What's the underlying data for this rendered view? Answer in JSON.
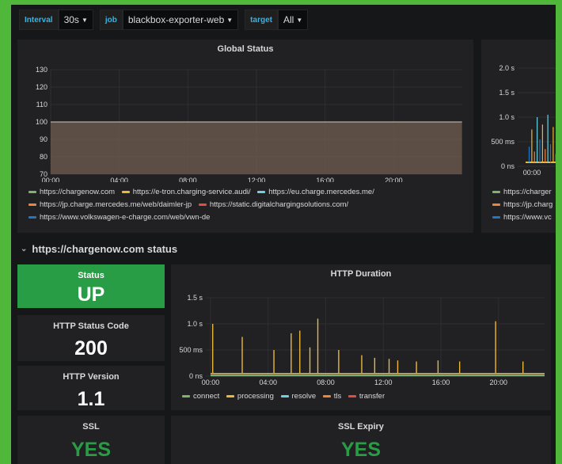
{
  "toolbar": {
    "variables": [
      {
        "label": "Interval",
        "value": "30s"
      },
      {
        "label": "job",
        "value": "blackbox-exporter-web"
      },
      {
        "label": "target",
        "value": "All"
      }
    ]
  },
  "colors": {
    "green": "#7eb26d",
    "yellow": "#eab839",
    "cyan": "#6ed0e0",
    "orange": "#ef843c",
    "red": "#e24d42",
    "blue": "#1f78c1",
    "status_up_bg": "#299c46",
    "ok_text": "#299c46"
  },
  "global_status": {
    "title": "Global Status",
    "legend": [
      {
        "label": "https://chargenow.com",
        "color": "#7eb26d"
      },
      {
        "label": "https://e-tron.charging-service.audi/",
        "color": "#eab839"
      },
      {
        "label": "https://eu.charge.mercedes.me/",
        "color": "#6ed0e0"
      },
      {
        "label": "https://jp.charge.mercedes.me/web/daimler-jp",
        "color": "#ef843c"
      },
      {
        "label": "https://static.digitalchargingsolutions.com/",
        "color": "#e24d42"
      },
      {
        "label": "https://www.volkswagen-e-charge.com/web/vwn-de",
        "color": "#1f78c1"
      }
    ]
  },
  "duration_panel": {
    "legend": [
      {
        "label": "https://charger",
        "color": "#7eb26d"
      },
      {
        "label": "https://jp.charg",
        "color": "#ef843c"
      },
      {
        "label": "https://www.vc",
        "color": "#1f78c1"
      }
    ]
  },
  "row": {
    "title": "https://chargenow.com status"
  },
  "stats": {
    "status": {
      "label": "Status",
      "value": "UP"
    },
    "http_status_code": {
      "label": "HTTP Status Code",
      "value": "200"
    },
    "http_version": {
      "label": "HTTP Version",
      "value": "1.1"
    },
    "ssl": {
      "label": "SSL",
      "value": "YES"
    },
    "ssl_expiry": {
      "label": "SSL Expiry",
      "value": "YES"
    }
  },
  "http_duration": {
    "title": "HTTP Duration",
    "legend": [
      {
        "label": "connect",
        "color": "#7eb26d"
      },
      {
        "label": "processing",
        "color": "#eab839"
      },
      {
        "label": "resolve",
        "color": "#6ed0e0"
      },
      {
        "label": "tls",
        "color": "#ef843c"
      },
      {
        "label": "transfer",
        "color": "#e24d42"
      }
    ]
  },
  "chart_data": [
    {
      "type": "area",
      "title": "Global Status",
      "x_ticks": [
        "00:00",
        "04:00",
        "08:00",
        "12:00",
        "16:00",
        "20:00"
      ],
      "y_ticks": [
        "70",
        "80",
        "90",
        "100",
        "110",
        "120",
        "130"
      ],
      "ylim": [
        70,
        130
      ],
      "grid": true,
      "legend_position": "bottom",
      "series": [
        {
          "name": "https://chargenow.com",
          "x": [
            "00:00",
            "23:59"
          ],
          "values": [
            100,
            100
          ]
        }
      ]
    },
    {
      "type": "line",
      "x_ticks": [
        "00:00"
      ],
      "y_ticks": [
        "0 ns",
        "500 ms",
        "1.0 s",
        "1.5 s",
        "2.0 s"
      ],
      "ylim": [
        0,
        2.0
      ],
      "grid": true,
      "legend_position": "bottom",
      "spike_times": [
        0.2,
        0.35,
        0.5,
        0.65,
        0.8,
        0.95,
        1.1,
        1.25,
        1.4,
        1.55,
        1.7,
        1.85,
        2.0,
        2.15,
        2.3
      ],
      "spike_values": [
        0.4,
        0.75,
        0.3,
        1.0,
        0.55,
        0.85,
        0.35,
        1.05,
        0.45,
        0.8,
        0.25,
        1.0,
        0.6,
        0.9,
        0.5
      ],
      "baseline": 0.08
    },
    {
      "type": "line",
      "title": "HTTP Duration",
      "x_ticks": [
        "00:00",
        "04:00",
        "08:00",
        "12:00",
        "16:00",
        "20:00"
      ],
      "y_ticks": [
        "0 ns",
        "500 ms",
        "1.0 s",
        "1.5 s"
      ],
      "ylim": [
        0,
        1.5
      ],
      "grid": true,
      "legend_position": "bottom",
      "baseline": 0.05,
      "spike_times": [
        0.15,
        2.2,
        4.4,
        5.6,
        6.2,
        6.9,
        7.45,
        8.9,
        10.5,
        11.4,
        12.4,
        13.0,
        14.3,
        15.8,
        17.3,
        19.8,
        21.7
      ],
      "spike_values": [
        1.0,
        0.75,
        0.5,
        0.82,
        0.87,
        0.55,
        1.1,
        0.5,
        0.4,
        0.35,
        0.33,
        0.3,
        0.28,
        0.3,
        0.28,
        1.05,
        0.28
      ]
    }
  ]
}
